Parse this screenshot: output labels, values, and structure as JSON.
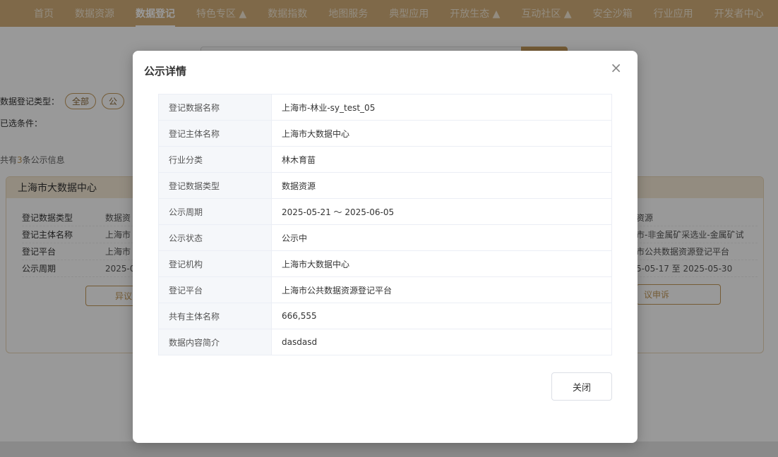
{
  "nav": {
    "items": [
      "首页",
      "数据资源",
      "数据登记",
      "特色专区 ▲",
      "数据指数",
      "地图服务",
      "典型应用",
      "开放生态 ▲",
      "互动社区 ▲",
      "安全沙箱",
      "行业应用",
      "开发者中心"
    ],
    "active_index": 2
  },
  "filters": {
    "type_label": "数据登记类型：",
    "chip_all": "全部",
    "chip_partial": "公",
    "selected_label": "已选条件："
  },
  "results": {
    "count_prefix": "共有",
    "count": "3",
    "count_suffix": "条公示信息"
  },
  "card_left": {
    "title": "上海市大数据中心",
    "rows": [
      {
        "k": "登记数据类型",
        "v": "数据资"
      },
      {
        "k": "登记主体名称",
        "v": "上海市"
      },
      {
        "k": "登记平台",
        "v": "上海市"
      },
      {
        "k": "公示周期",
        "v": "2025-0"
      }
    ],
    "button": "异议申"
  },
  "card_right": {
    "rows": [
      "资源",
      "市-非金属矿采选业-金属矿试",
      "市公共数据资源登记平台",
      "5-05-17 至 2025-05-30"
    ],
    "button": "议申诉"
  },
  "modal": {
    "title": "公示详情",
    "close_icon": "×",
    "rows": [
      {
        "k": "登记数据名称",
        "v": "上海市-林业-sy_test_05"
      },
      {
        "k": "登记主体名称",
        "v": "上海市大数据中心"
      },
      {
        "k": "行业分类",
        "v": "林木育苗"
      },
      {
        "k": "登记数据类型",
        "v": "数据资源"
      },
      {
        "k": "公示周期",
        "v": "2025-05-21 ～ 2025-06-05"
      },
      {
        "k": "公示状态",
        "v": "公示中"
      },
      {
        "k": "登记机构",
        "v": "上海市大数据中心"
      },
      {
        "k": "登记平台",
        "v": "上海市公共数据资源登记平台"
      },
      {
        "k": "共有主体名称",
        "v": "666,555"
      },
      {
        "k": "数据内容简介",
        "v": "dasdasd"
      }
    ],
    "close_button": "关闭"
  },
  "colors": {
    "brand": "#d4b07a",
    "accent": "#c49a5a"
  }
}
